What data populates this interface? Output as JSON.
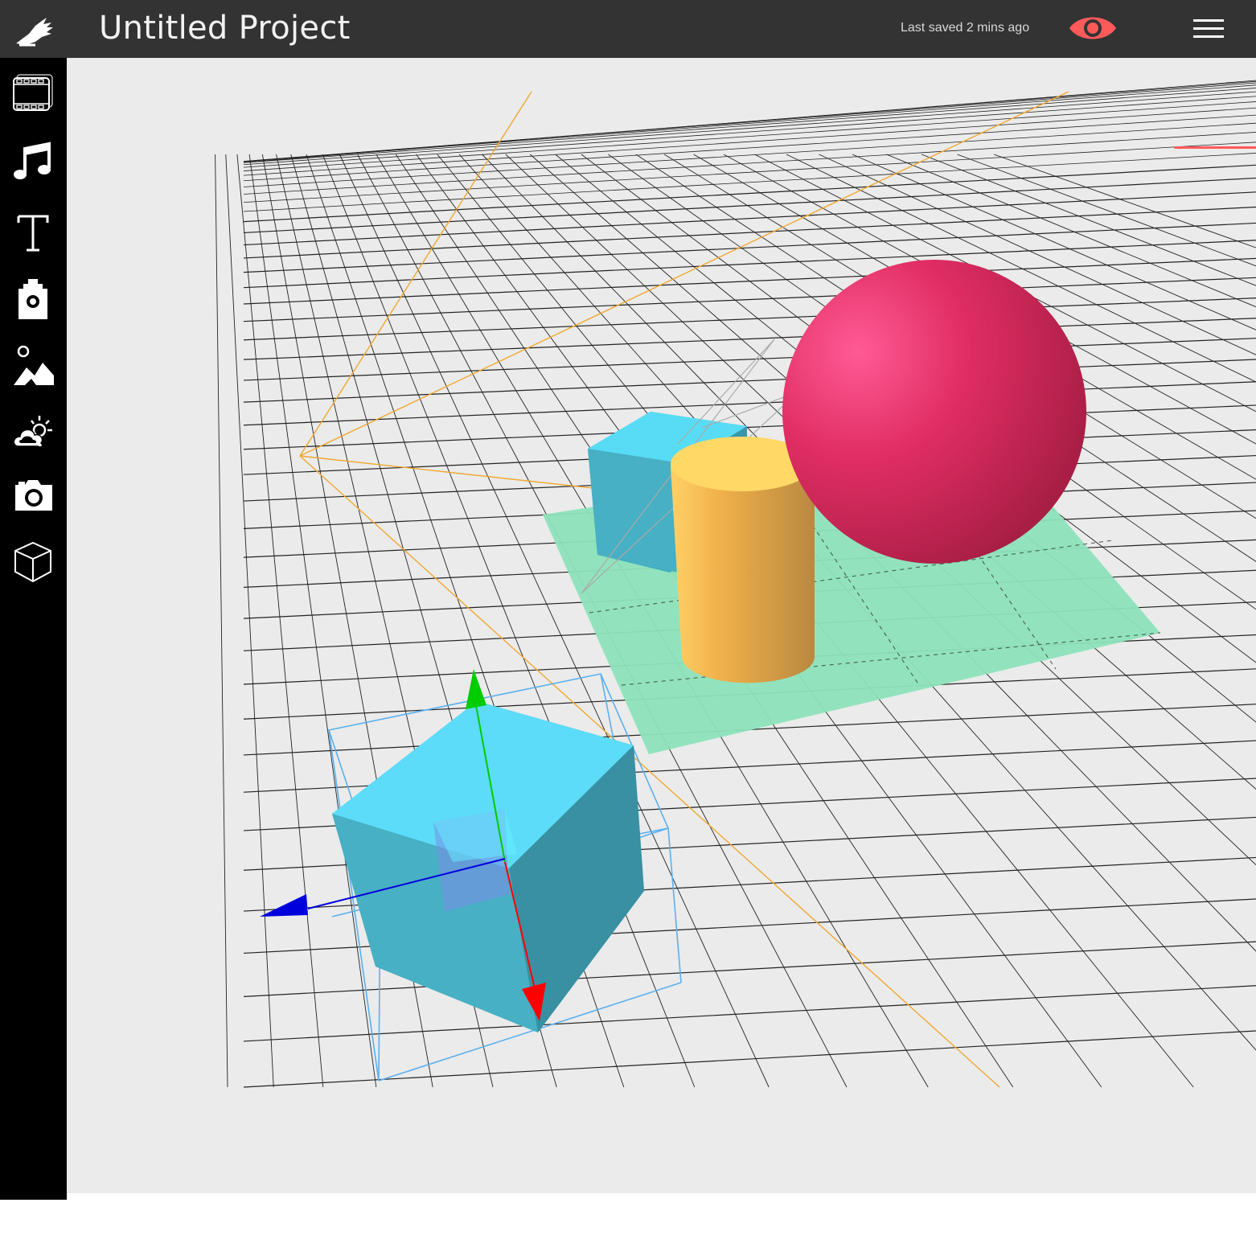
{
  "header": {
    "title": "Untitled Project",
    "save_status": "Last saved 2 mins ago",
    "preview_icon": "eye-icon",
    "menu_icon": "hamburger-menu-icon",
    "logo_icon": "hand-logo-icon"
  },
  "sidebar": {
    "tools": [
      {
        "name": "scenes",
        "icon": "film-strip-icon"
      },
      {
        "name": "audio",
        "icon": "music-note-icon"
      },
      {
        "name": "text",
        "icon": "text-icon"
      },
      {
        "name": "lights",
        "icon": "lantern-icon"
      },
      {
        "name": "environment",
        "icon": "landscape-icon"
      },
      {
        "name": "weather",
        "icon": "cloud-sun-icon"
      },
      {
        "name": "camera",
        "icon": "camera-icon"
      },
      {
        "name": "objects",
        "icon": "cube-icon"
      }
    ]
  },
  "scene": {
    "objects": [
      {
        "name": "selected-cube",
        "shape": "cube",
        "color": "#4fc8e0"
      },
      {
        "name": "back-cube",
        "shape": "cube",
        "color": "#4fc8e0"
      },
      {
        "name": "cylinder",
        "shape": "cylinder",
        "color": "#f5b94a"
      },
      {
        "name": "sphere",
        "shape": "sphere",
        "color": "#e0245c"
      },
      {
        "name": "floor-plane",
        "shape": "plane",
        "color": "#8de3bb"
      }
    ],
    "gizmo_colors": {
      "x": "#ff0000",
      "y": "#00cc00",
      "z": "#0000ff"
    },
    "accent": "#ff5a5a"
  }
}
